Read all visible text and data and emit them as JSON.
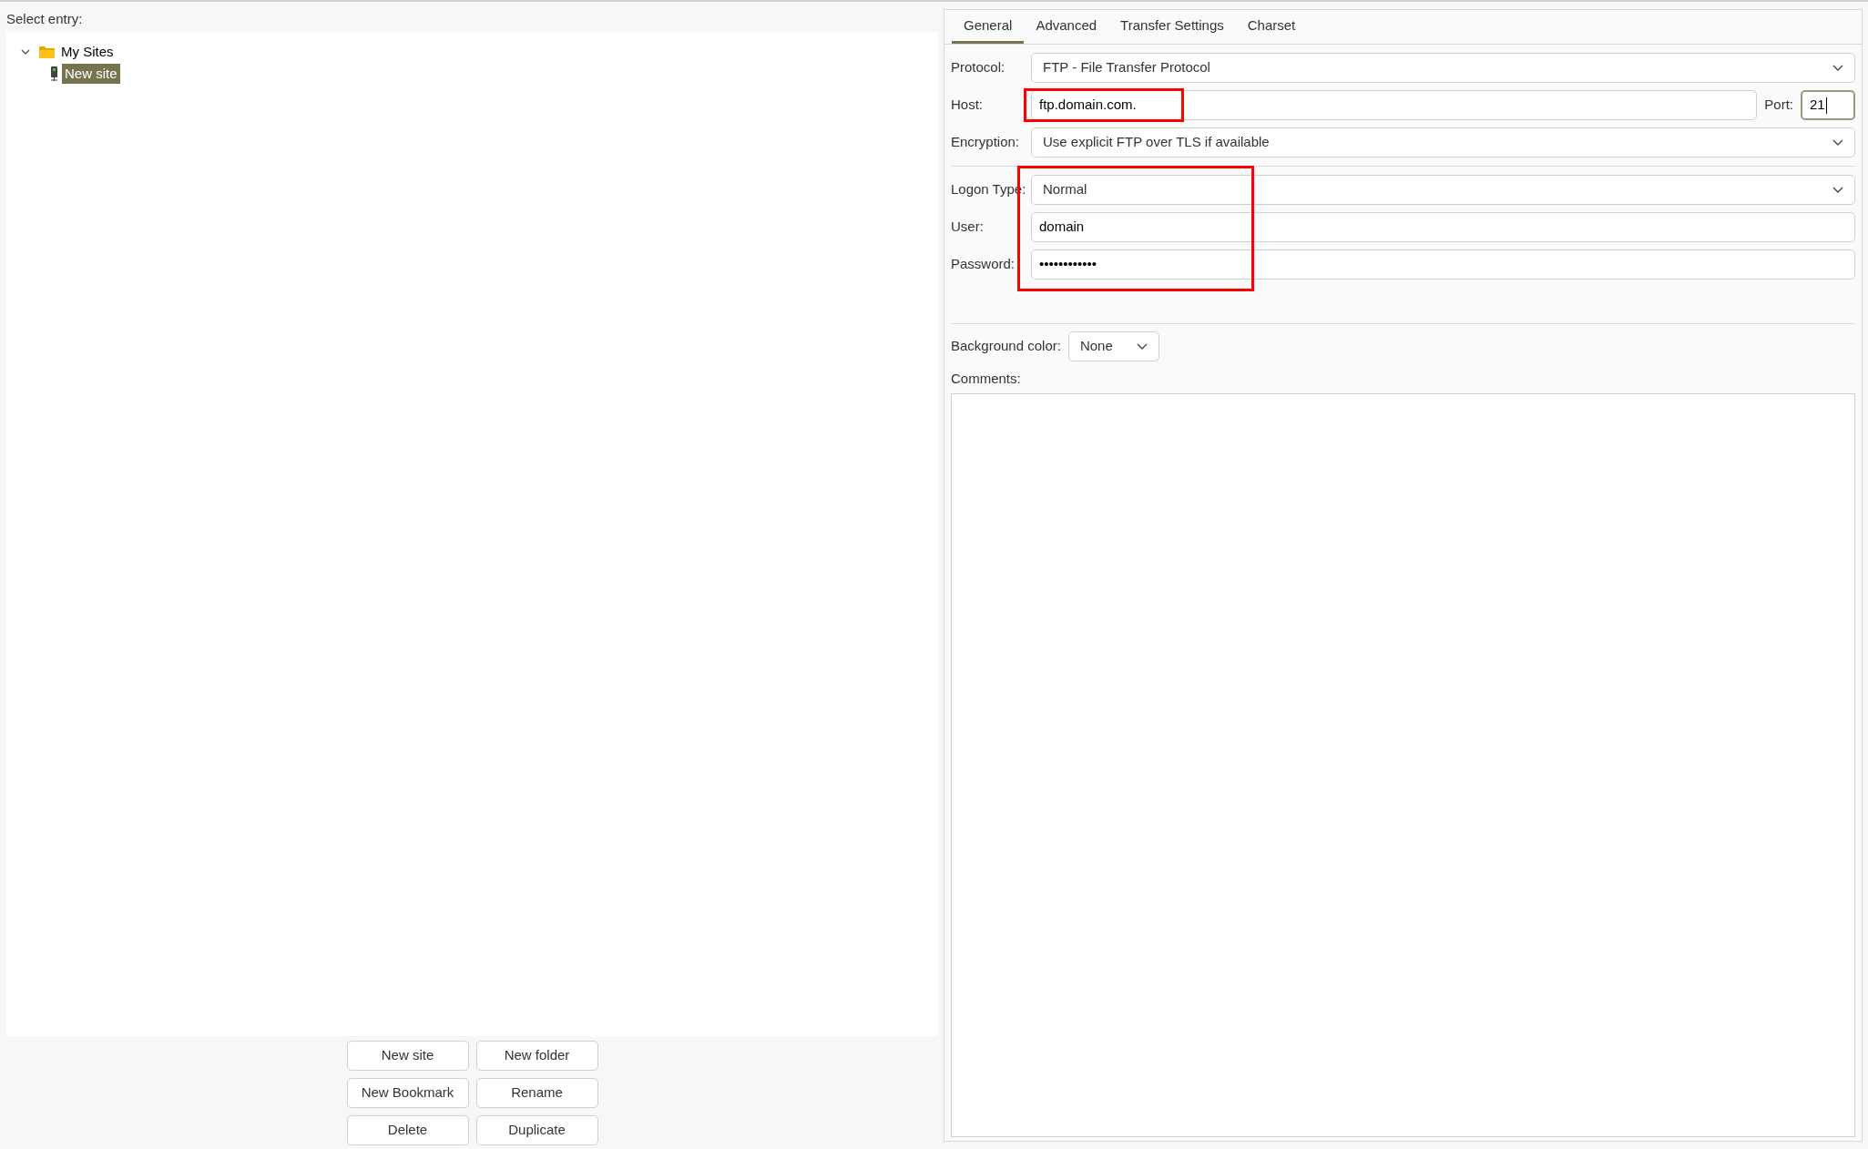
{
  "site_tree": {
    "label": "Select entry:",
    "items": [
      {
        "label": "My Sites",
        "kind": "folder",
        "expanded": true,
        "selected": false,
        "children": [
          {
            "label": "New site",
            "kind": "site",
            "selected": true
          }
        ]
      }
    ]
  },
  "tree_buttons": [
    [
      "New site",
      "New folder"
    ],
    [
      "New Bookmark",
      "Rename"
    ],
    [
      "Delete",
      "Duplicate"
    ]
  ],
  "tabs": [
    {
      "label": "General",
      "selected": true
    },
    {
      "label": "Advanced",
      "selected": false
    },
    {
      "label": "Transfer Settings",
      "selected": false
    },
    {
      "label": "Charset",
      "selected": false
    }
  ],
  "connection": [
    {
      "kind": "select",
      "label": "Protocol:",
      "value": "FTP - File Transfer Protocol"
    },
    {
      "kind": "host",
      "label": "Host:",
      "value": "ftp.domain.com.",
      "highlighted": true,
      "port_label": "Port:",
      "port_value": "21"
    },
    {
      "kind": "select",
      "label": "Encryption:",
      "value": "Use explicit FTP over TLS if available"
    }
  ],
  "credentials": {
    "highlighted": true,
    "fields": [
      {
        "kind": "select",
        "label": "Logon Type:",
        "value": "Normal"
      },
      {
        "kind": "text",
        "label": "User:",
        "value": "domain"
      },
      {
        "kind": "password",
        "label": "Password:",
        "value": "••••••••••••"
      }
    ]
  },
  "background_color": {
    "label": "Background color:",
    "value": "None"
  },
  "comments": {
    "label": "Comments:"
  }
}
